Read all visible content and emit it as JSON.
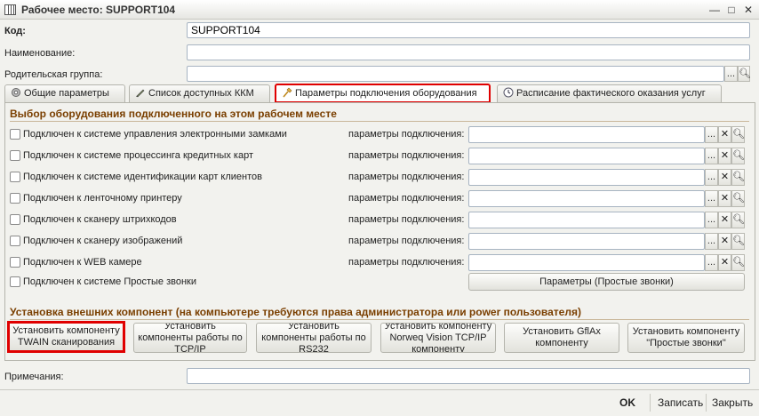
{
  "window": {
    "title": "Рабочее место: SUPPORT104"
  },
  "form": {
    "code_label": "Код:",
    "code_value": "SUPPORT104",
    "name_label": "Наименование:",
    "name_value": "",
    "parent_label": "Родительская группа:",
    "parent_value": "",
    "dots": "..."
  },
  "tabs": [
    {
      "label": "Общие параметры",
      "icon": "gear-icon"
    },
    {
      "label": "Список доступных ККМ",
      "icon": "pen-icon"
    },
    {
      "label": "Параметры подключения оборудования",
      "icon": "plug-icon",
      "active": true
    },
    {
      "label": "Расписание фактического оказания услуг",
      "icon": "clock-icon"
    }
  ],
  "equipment": {
    "title": "Выбор оборудования подключенного на этом рабочем месте",
    "params_label": "параметры подключения:",
    "items": [
      {
        "label": "Подключен к системе управления электронными замками",
        "checked": false
      },
      {
        "label": "Подключен к системе процессинга кредитных карт",
        "checked": false
      },
      {
        "label": "Подключен к системе идентификации карт клиентов",
        "checked": false
      },
      {
        "label": "Подключен к ленточному принтеру",
        "checked": false
      },
      {
        "label": "Подключен к сканеру штрихкодов",
        "checked": false
      },
      {
        "label": "Подключен к сканеру изображений",
        "checked": false
      },
      {
        "label": "Подключен к WEB камере",
        "checked": false
      },
      {
        "label": "Подключен к системе Простые звонки",
        "checked": false
      }
    ],
    "simple_calls_button": "Параметры (Простые звонки)"
  },
  "components": {
    "title": "Установка внешних компонент (на компьютере требуются права администратора или power пользователя)",
    "buttons": [
      "Установить компоненту TWAIN сканирования",
      "Установить компоненты работы по TCP/IP",
      "Установить компоненты работы по RS232",
      "Установить компоненту Norweq Vision TCP/IP компоненту",
      "Установить GflAx компоненту",
      "Установить компоненту \"Простые звонки\""
    ]
  },
  "notes": {
    "label": "Примечания:",
    "value": ""
  },
  "footer": {
    "ok": "OK",
    "save": "Записать",
    "close": "Закрыть"
  },
  "colors": {
    "highlight": "#e00000",
    "group_title": "#7a3f00"
  }
}
